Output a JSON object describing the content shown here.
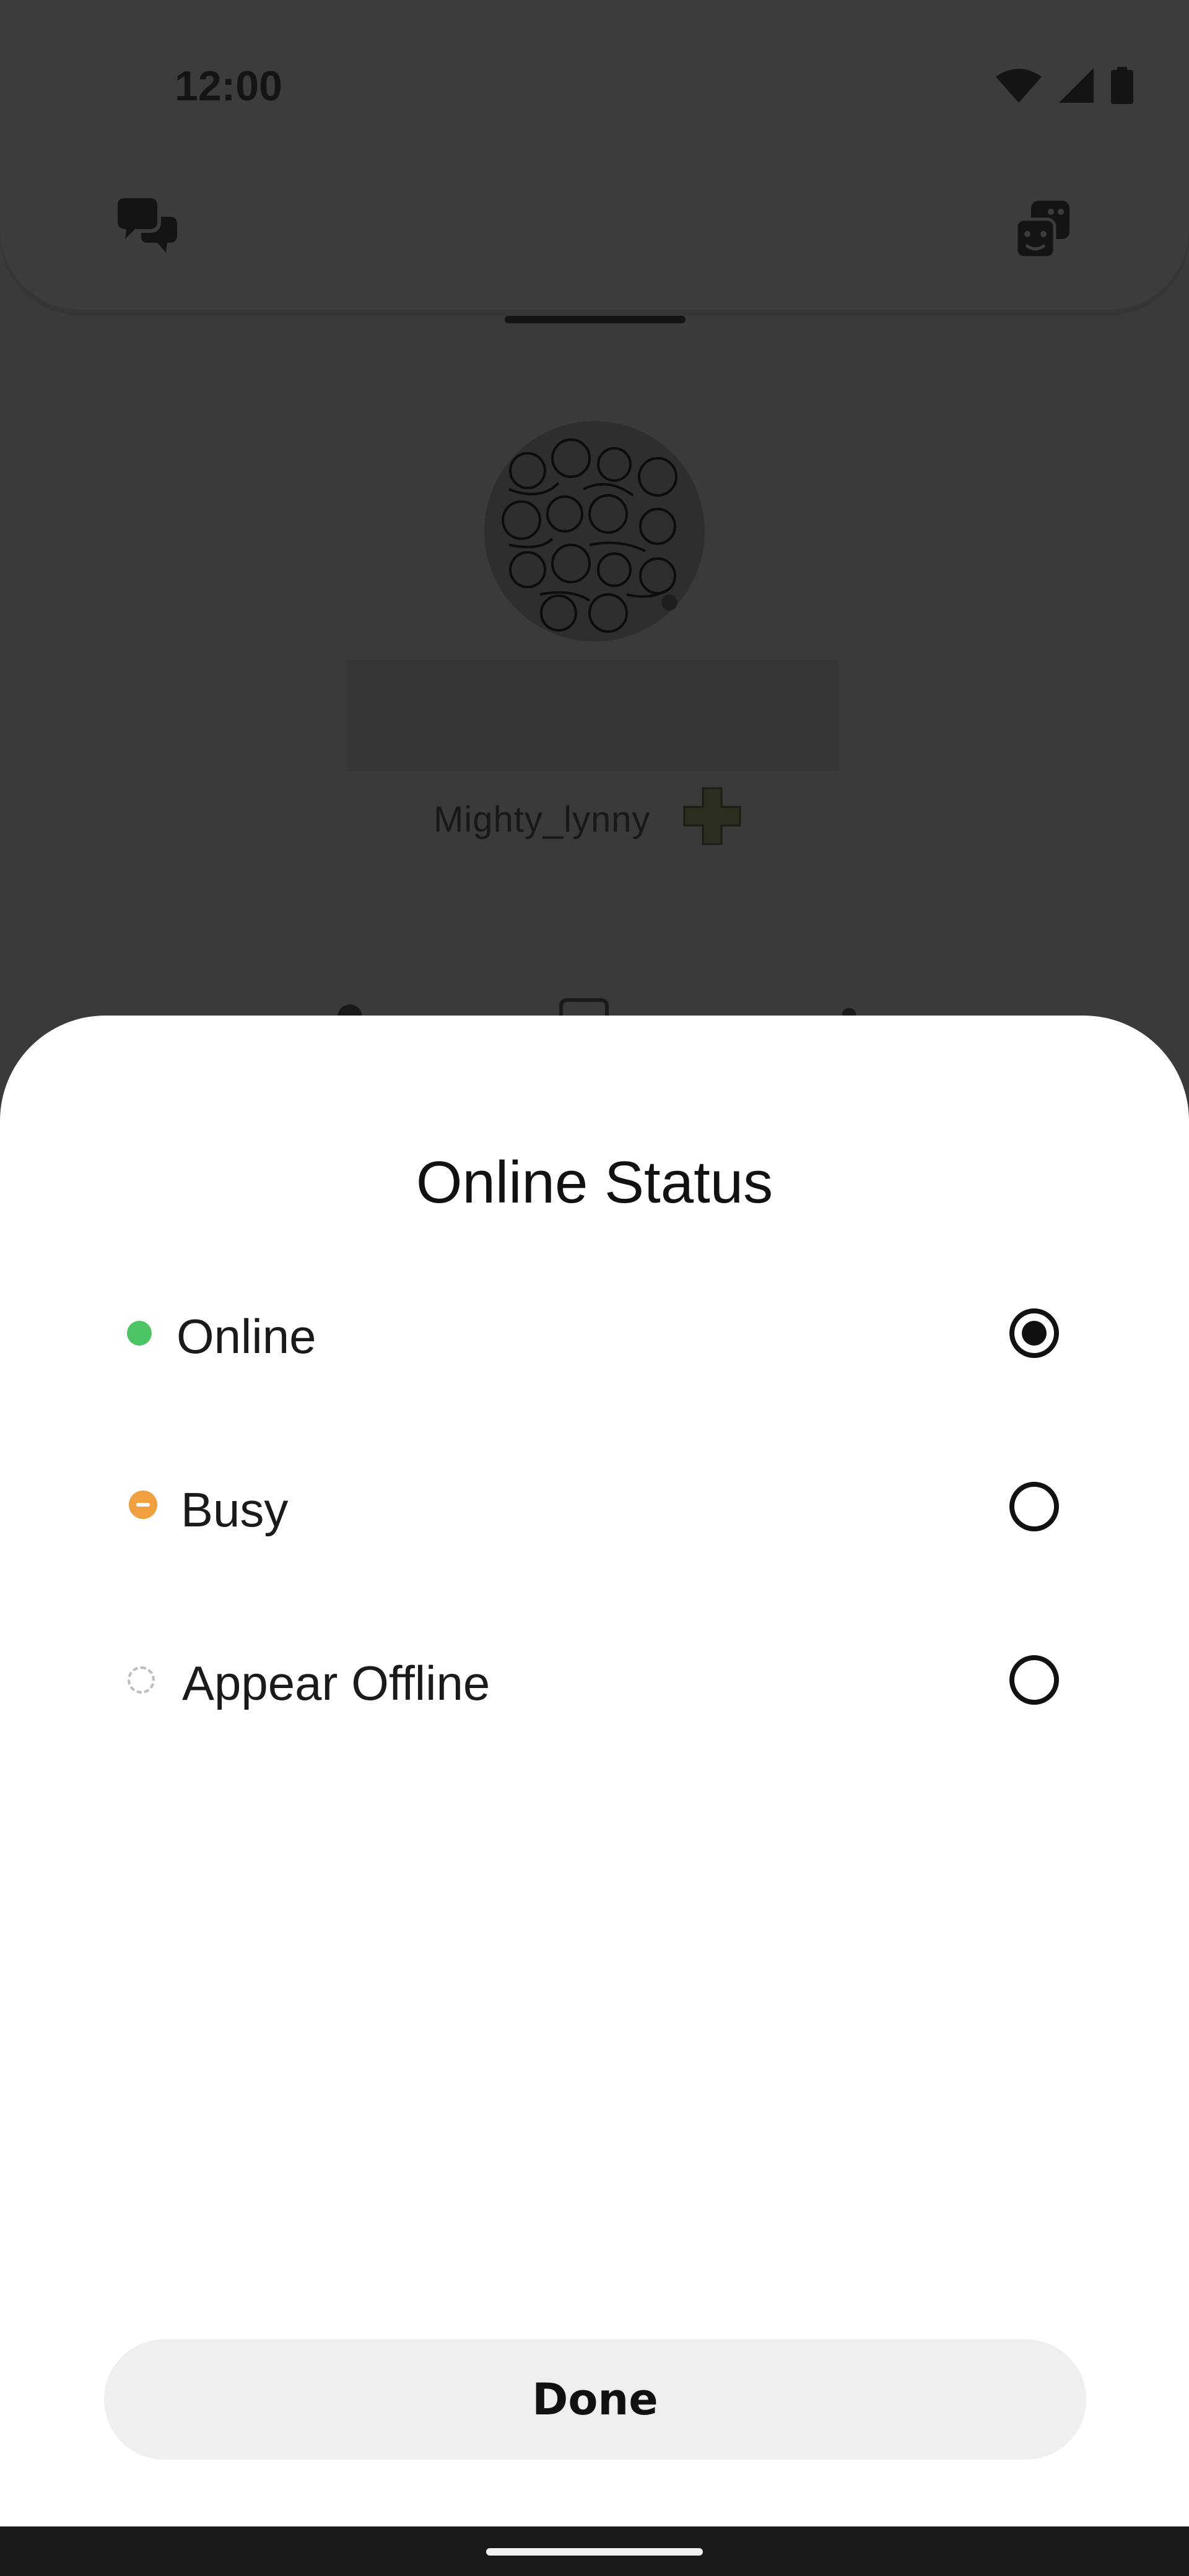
{
  "status_bar": {
    "time": "12:00"
  },
  "profile": {
    "username": "Mighty_lynny"
  },
  "sheet": {
    "title": "Online Status",
    "options": [
      {
        "label": "Online",
        "status_color": "#4cc463",
        "selected": true
      },
      {
        "label": "Busy",
        "status_color": "#f0a040",
        "selected": false
      },
      {
        "label": "Appear Offline",
        "status_color": "#bdbdbd",
        "selected": false
      }
    ],
    "done_label": "Done"
  },
  "icons": [
    "chat-bubbles-icon",
    "dice-icon",
    "wifi-icon",
    "signal-icon",
    "battery-icon",
    "dpad-badge-icon"
  ]
}
